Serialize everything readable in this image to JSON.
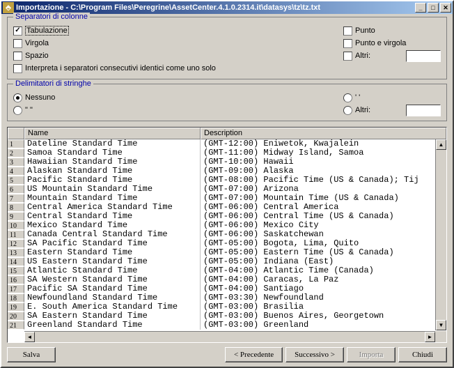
{
  "window": {
    "title": "Importazione - C:\\Program Files\\Peregrine\\AssetCenter.4.1.0.2314.it\\datasys\\tz\\tz.txt"
  },
  "separators": {
    "legend": "Separatori di colonne",
    "tab": "Tabulazione",
    "comma": "Virgola",
    "space": "Spazio",
    "dot": "Punto",
    "semicolon": "Punto e virgola",
    "other": "Altri:",
    "consecutive": "Interpreta i separatori consecutivi identici come uno solo"
  },
  "delimiters": {
    "legend": "Delimitatori di stringhe",
    "none": "Nessuno",
    "doublequote": "\" \"",
    "singlequote": "' '",
    "other": "Altri:"
  },
  "table": {
    "headers": {
      "name": "Name",
      "description": "Description"
    },
    "rows": [
      {
        "n": "1",
        "name": "Dateline Standard Time",
        "desc": "(GMT-12:00) Eniwetok, Kwajalein"
      },
      {
        "n": "2",
        "name": "Samoa Standard Time",
        "desc": "(GMT-11:00) Midway Island, Samoa"
      },
      {
        "n": "3",
        "name": "Hawaiian Standard Time",
        "desc": "(GMT-10:00) Hawaii"
      },
      {
        "n": "4",
        "name": "Alaskan Standard Time",
        "desc": "(GMT-09:00) Alaska"
      },
      {
        "n": "5",
        "name": "Pacific Standard Time",
        "desc": "(GMT-08:00) Pacific Time (US & Canada); Tij"
      },
      {
        "n": "6",
        "name": "US Mountain Standard Time",
        "desc": "(GMT-07:00) Arizona"
      },
      {
        "n": "7",
        "name": "Mountain Standard Time",
        "desc": "(GMT-07:00) Mountain Time (US & Canada)"
      },
      {
        "n": "8",
        "name": "Central America Standard Time",
        "desc": "(GMT-06:00) Central America"
      },
      {
        "n": "9",
        "name": "Central Standard Time",
        "desc": "(GMT-06:00) Central Time (US & Canada)"
      },
      {
        "n": "10",
        "name": "Mexico Standard Time",
        "desc": "(GMT-06:00) Mexico City"
      },
      {
        "n": "11",
        "name": "Canada Central Standard Time",
        "desc": "(GMT-06:00) Saskatchewan"
      },
      {
        "n": "12",
        "name": "SA Pacific Standard Time",
        "desc": "(GMT-05:00) Bogota, Lima, Quito"
      },
      {
        "n": "13",
        "name": "Eastern Standard Time",
        "desc": "(GMT-05:00) Eastern Time (US & Canada)"
      },
      {
        "n": "14",
        "name": "US Eastern Standard Time",
        "desc": "(GMT-05:00) Indiana (East)"
      },
      {
        "n": "15",
        "name": "Atlantic Standard Time",
        "desc": "(GMT-04:00) Atlantic Time (Canada)"
      },
      {
        "n": "16",
        "name": "SA Western Standard Time",
        "desc": "(GMT-04:00) Caracas, La Paz"
      },
      {
        "n": "17",
        "name": "Pacific SA Standard Time",
        "desc": "(GMT-04:00) Santiago"
      },
      {
        "n": "18",
        "name": "Newfoundland Standard Time",
        "desc": "(GMT-03:30) Newfoundland"
      },
      {
        "n": "19",
        "name": "E. South America Standard Time",
        "desc": "(GMT-03:00) Brasilia"
      },
      {
        "n": "20",
        "name": "SA Eastern Standard Time",
        "desc": "(GMT-03:00) Buenos Aires, Georgetown"
      },
      {
        "n": "21",
        "name": "Greenland Standard Time",
        "desc": "(GMT-03:00) Greenland"
      }
    ]
  },
  "buttons": {
    "save": "Salva",
    "prev": "< Precedente",
    "next": "Successivo >",
    "import": "Importa",
    "close": "Chiudi"
  }
}
